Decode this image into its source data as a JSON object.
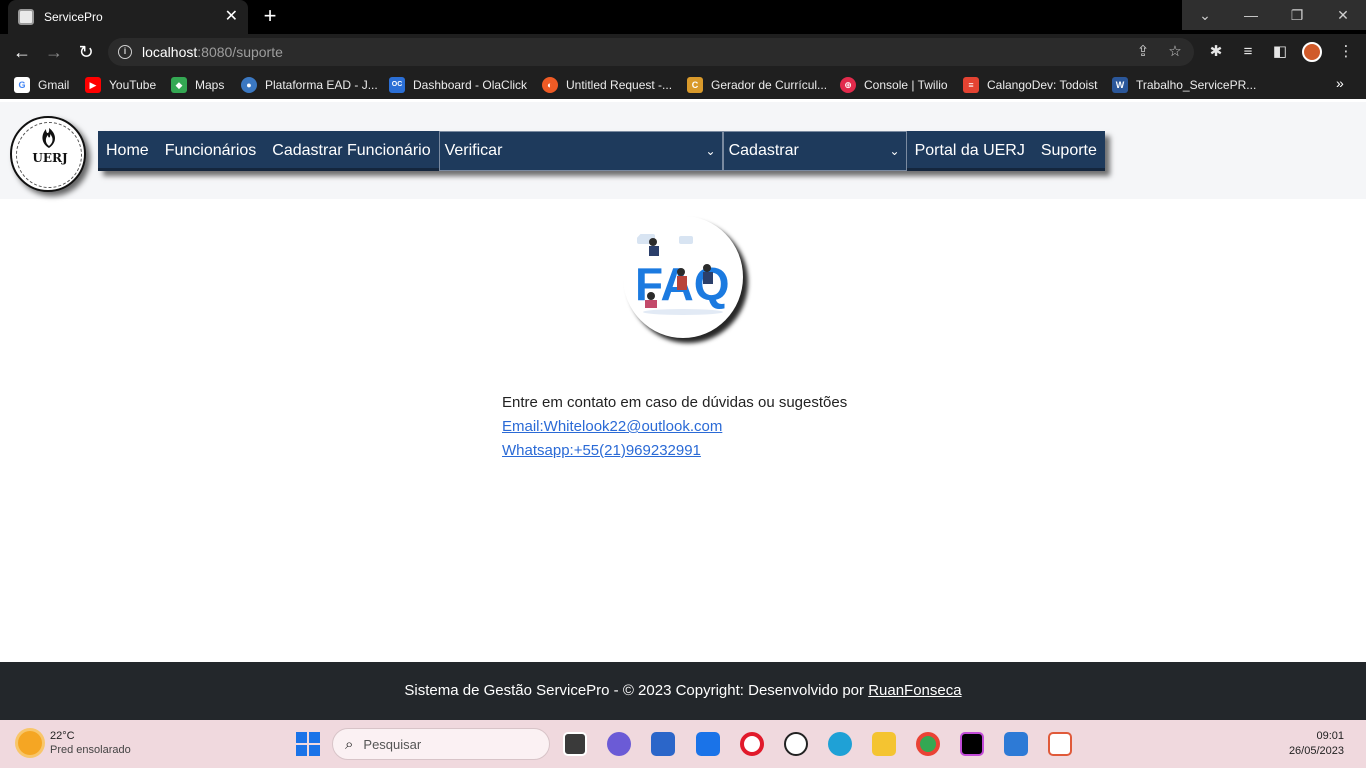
{
  "browser": {
    "tab_title": "ServicePro",
    "tab_close": "✕",
    "new_tab": "+",
    "url_host": "localhost",
    "url_path": ":8080/suporte",
    "window_controls": [
      "⌄",
      "—",
      "❐",
      "✕"
    ]
  },
  "bookmarks": [
    {
      "label": "Gmail",
      "icon": "G",
      "color": "#ffffff"
    },
    {
      "label": "YouTube",
      "icon": "▶",
      "color": "#ff0000"
    },
    {
      "label": "Maps",
      "icon": "◆",
      "color": "#34a853"
    },
    {
      "label": "Plataforma EAD - J...",
      "icon": "●",
      "color": "#3b78c2"
    },
    {
      "label": "Dashboard - OlaClick",
      "icon": "OC",
      "color": "#2b6fd6"
    },
    {
      "label": "Untitled Request -...",
      "icon": "◐",
      "color": "#ef5b25"
    },
    {
      "label": "Gerador de Currícul...",
      "icon": "C",
      "color": "#d99a2b"
    },
    {
      "label": "Console | Twilio",
      "icon": "⊕",
      "color": "#e22b4c"
    },
    {
      "label": "CalangoDev: Todoist",
      "icon": "≡",
      "color": "#e44332"
    },
    {
      "label": "Trabalho_ServicePR...",
      "icon": "W",
      "color": "#2b579a"
    }
  ],
  "site": {
    "logo_text": "UERJ",
    "nav": {
      "home": "Home",
      "funcionarios": "Funcionários",
      "cadastrar_funcionario": "Cadastrar Funcionário",
      "verificar": "Verificar",
      "cadastrar": "Cadastrar",
      "portal": "Portal da UERJ",
      "suporte": "Suporte"
    },
    "faq_image_text": "FAQ",
    "contact": {
      "intro": "Entre em contato em caso de dúvidas ou sugestões",
      "email": "Email:Whitelook22@outlook.com",
      "whatsapp": "Whatsapp:+55(21)969232991"
    },
    "footer": {
      "text": "Sistema de Gestão ServicePro - © 2023 Copyright: Desenvolvido por ",
      "author": "RuanFonseca"
    }
  },
  "taskbar": {
    "temperature": "22°C",
    "weather": "Pred ensolarado",
    "search_placeholder": "Pesquisar",
    "time": "09:01",
    "date": "26/05/2023"
  }
}
